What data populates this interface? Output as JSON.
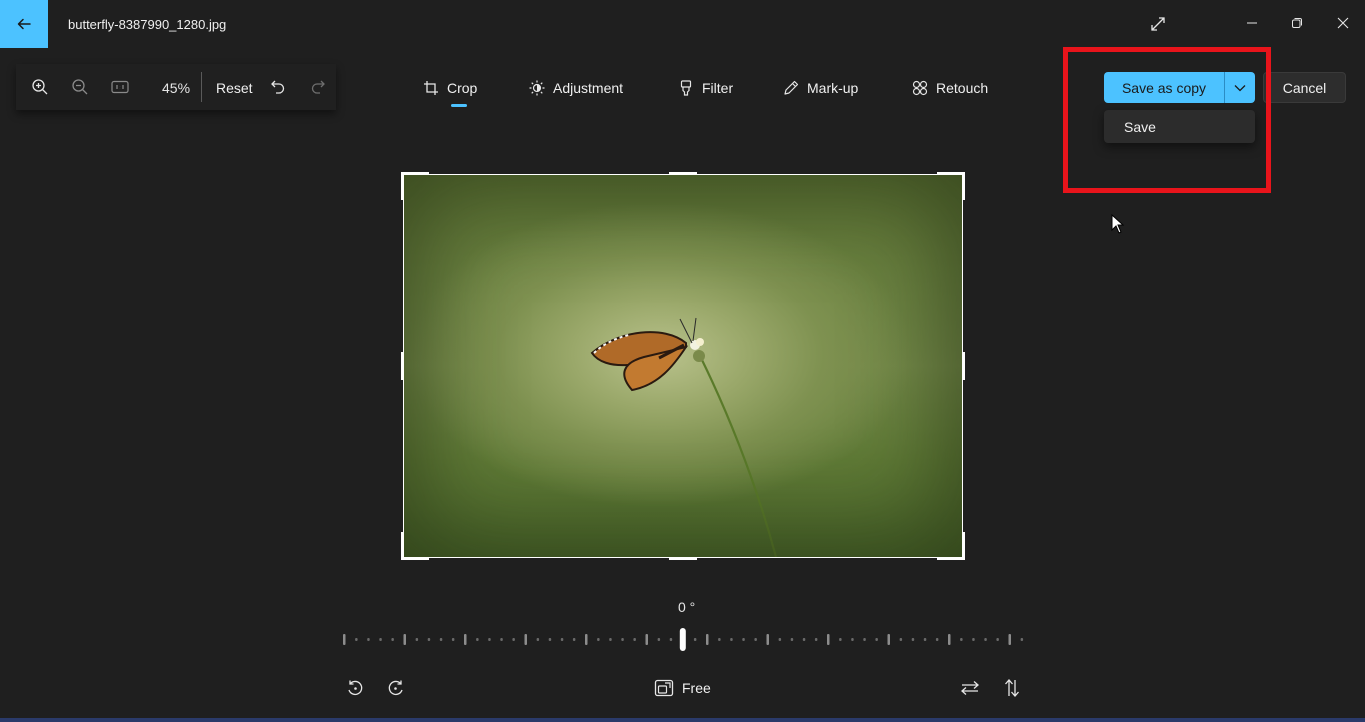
{
  "window": {
    "title": "butterfly-8387990_1280.jpg"
  },
  "zoom": {
    "level": "45%",
    "reset_label": "Reset"
  },
  "tabs": [
    {
      "label": "Crop",
      "icon": "crop-icon",
      "active": true
    },
    {
      "label": "Adjustment",
      "icon": "brightness-icon",
      "active": false
    },
    {
      "label": "Filter",
      "icon": "filter-icon",
      "active": false
    },
    {
      "label": "Mark-up",
      "icon": "pen-icon",
      "active": false
    },
    {
      "label": "Retouch",
      "icon": "retouch-icon",
      "active": false
    }
  ],
  "actions": {
    "save_as_copy_label": "Save as copy",
    "cancel_label": "Cancel",
    "dropdown_items": [
      {
        "label": "Save"
      }
    ]
  },
  "crop": {
    "angle": "0 °",
    "aspect_label": "Free"
  },
  "colors": {
    "accent": "#4cc2ff",
    "background": "#1f1f1f",
    "highlight": "#e8141b"
  }
}
